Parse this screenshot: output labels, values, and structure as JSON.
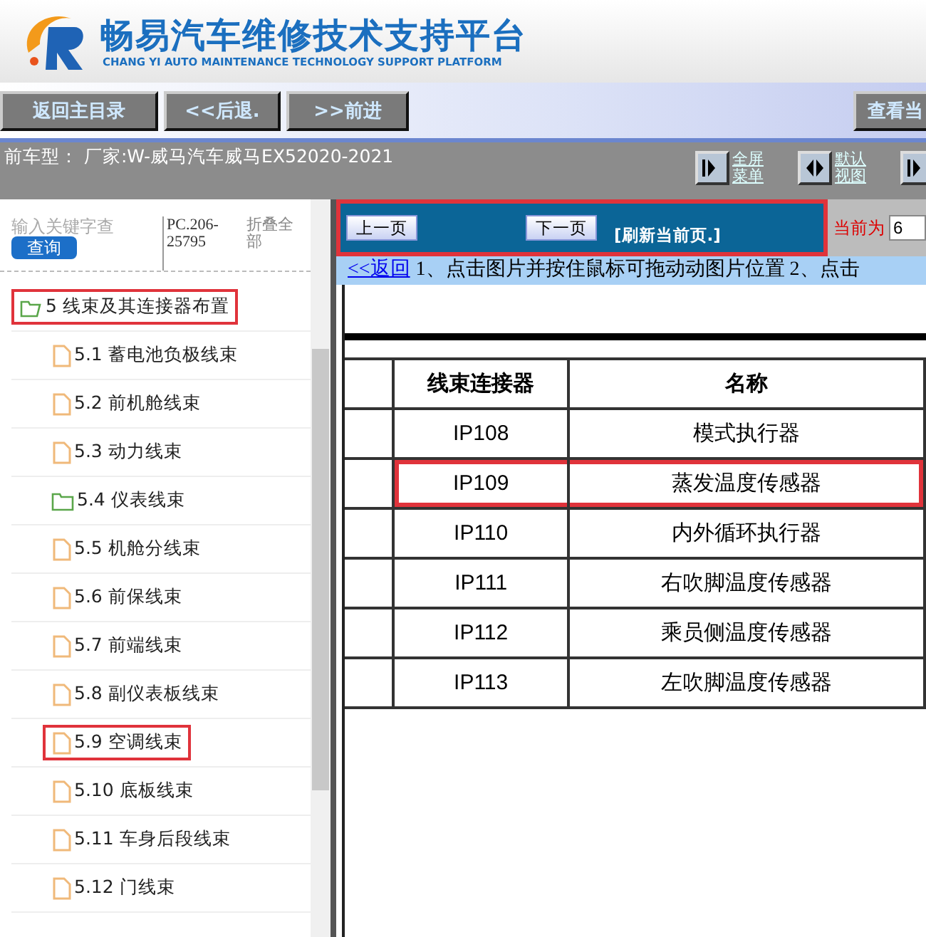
{
  "header": {
    "title": "畅易汽车维修技术支持平台",
    "subtitle": "CHANG YI AUTO MAINTENANCE TECHNOLOGY SUPPORT PLATFORM"
  },
  "toolbar": {
    "buttons": [
      "返回主目录",
      "<<后退.",
      ">>前进"
    ],
    "right_button": "查看当"
  },
  "model_bar": {
    "text": "前车型： 厂家:W-威马汽车威马EX52020-2021",
    "view_links": [
      {
        "label": "全屏菜单",
        "kind": "single"
      },
      {
        "label": "默认视图",
        "kind": "double"
      },
      {
        "kind": "single"
      }
    ]
  },
  "search": {
    "placeholder": "输入关键字查",
    "button": "查询",
    "code": "PC.206-25795",
    "collapse": "折叠全部"
  },
  "tree": [
    {
      "label": "5 线束及其连接器布置",
      "kind": "folder",
      "expanded": true,
      "highlighted": true,
      "children": [
        {
          "label": "5.1 蓄电池负极线束",
          "kind": "file",
          "highlighted": false
        },
        {
          "label": "5.2 前机舱线束",
          "kind": "file",
          "highlighted": false
        },
        {
          "label": "5.3 动力线束",
          "kind": "file",
          "highlighted": false
        },
        {
          "label": "5.4 仪表线束",
          "kind": "folder",
          "expanded": false,
          "highlighted": false
        },
        {
          "label": "5.5 机舱分线束",
          "kind": "file",
          "highlighted": false
        },
        {
          "label": "5.6 前保线束",
          "kind": "file",
          "highlighted": false
        },
        {
          "label": "5.7 前端线束",
          "kind": "file",
          "highlighted": false
        },
        {
          "label": "5.8 副仪表板线束",
          "kind": "file",
          "highlighted": false
        },
        {
          "label": "5.9 空调线束",
          "kind": "file",
          "highlighted": true
        },
        {
          "label": "5.10 底板线束",
          "kind": "file",
          "highlighted": false
        },
        {
          "label": "5.11 车身后段线束",
          "kind": "file",
          "highlighted": false
        },
        {
          "label": "5.12 门线束",
          "kind": "file",
          "highlighted": false
        }
      ]
    }
  ],
  "pager": {
    "prev": "上一页",
    "next": "下一页",
    "refresh": "[刷新当前页.]",
    "highlighted": true,
    "current_label": "当前为",
    "current_value": "6"
  },
  "hint": {
    "back_link": "<<返回",
    "text": "1、点击图片并按住鼠标可拖动动图片位置 2、点击"
  },
  "table": {
    "columns": [
      "线束连接器",
      "名称"
    ],
    "rows": [
      {
        "cells": [
          "IP108",
          "模式执行器"
        ],
        "highlighted": false
      },
      {
        "cells": [
          "IP109",
          "蒸发温度传感器"
        ],
        "highlighted": true
      },
      {
        "cells": [
          "IP110",
          "内外循环执行器"
        ],
        "highlighted": false
      },
      {
        "cells": [
          "IP111",
          "右吹脚温度传感器"
        ],
        "highlighted": false
      },
      {
        "cells": [
          "IP112",
          "乘员侧温度传感器"
        ],
        "highlighted": false
      },
      {
        "cells": [
          "IP113",
          "左吹脚温度传感器"
        ],
        "highlighted": false
      }
    ]
  }
}
